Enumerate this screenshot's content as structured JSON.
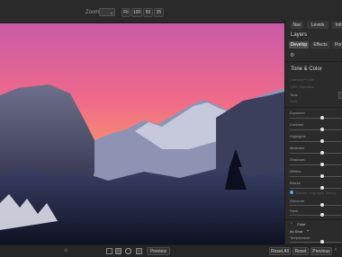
{
  "toolbar": {
    "zoom_label": "Zoom",
    "zoom_value": "",
    "zoom_buttons": [
      "Fit",
      "100",
      "50",
      "25"
    ]
  },
  "panel": {
    "top_tabs": [
      "Nav",
      "Levels",
      "Info"
    ],
    "layers_title": "Layers",
    "sub_tabs": [
      "Develop",
      "Effects",
      "Portrait"
    ],
    "section_title": "Tone & Color",
    "camera_profile_label": "Camera Profile",
    "camera_profile_value": "CMC Standard",
    "tone_label": "Tone",
    "auto_label": "Auto",
    "sliders": [
      {
        "label": "Exposure",
        "value": 0.5
      },
      {
        "label": "Contrast",
        "value": 0.5
      },
      {
        "label": "Highlights",
        "value": 0.5
      },
      {
        "label": "Midtones",
        "value": 0.5
      },
      {
        "label": "Shadows",
        "value": 0.5
      },
      {
        "label": "Whites",
        "value": 0.5
      },
      {
        "label": "Blacks",
        "value": 0.5
      }
    ],
    "toggle_label": "Blacks · Highlight Toning",
    "more_sliders": [
      {
        "label": "Structure",
        "value": 0.5
      },
      {
        "label": "Haze",
        "value": 0.5
      }
    ],
    "color_label": "Color",
    "wb_value": "As Shot",
    "temperature_label": "Temperature"
  },
  "bottom": {
    "preview_button": "Preview",
    "reset_all_button": "Reset All",
    "reset_button": "Reset",
    "previous_button": "Previous"
  }
}
